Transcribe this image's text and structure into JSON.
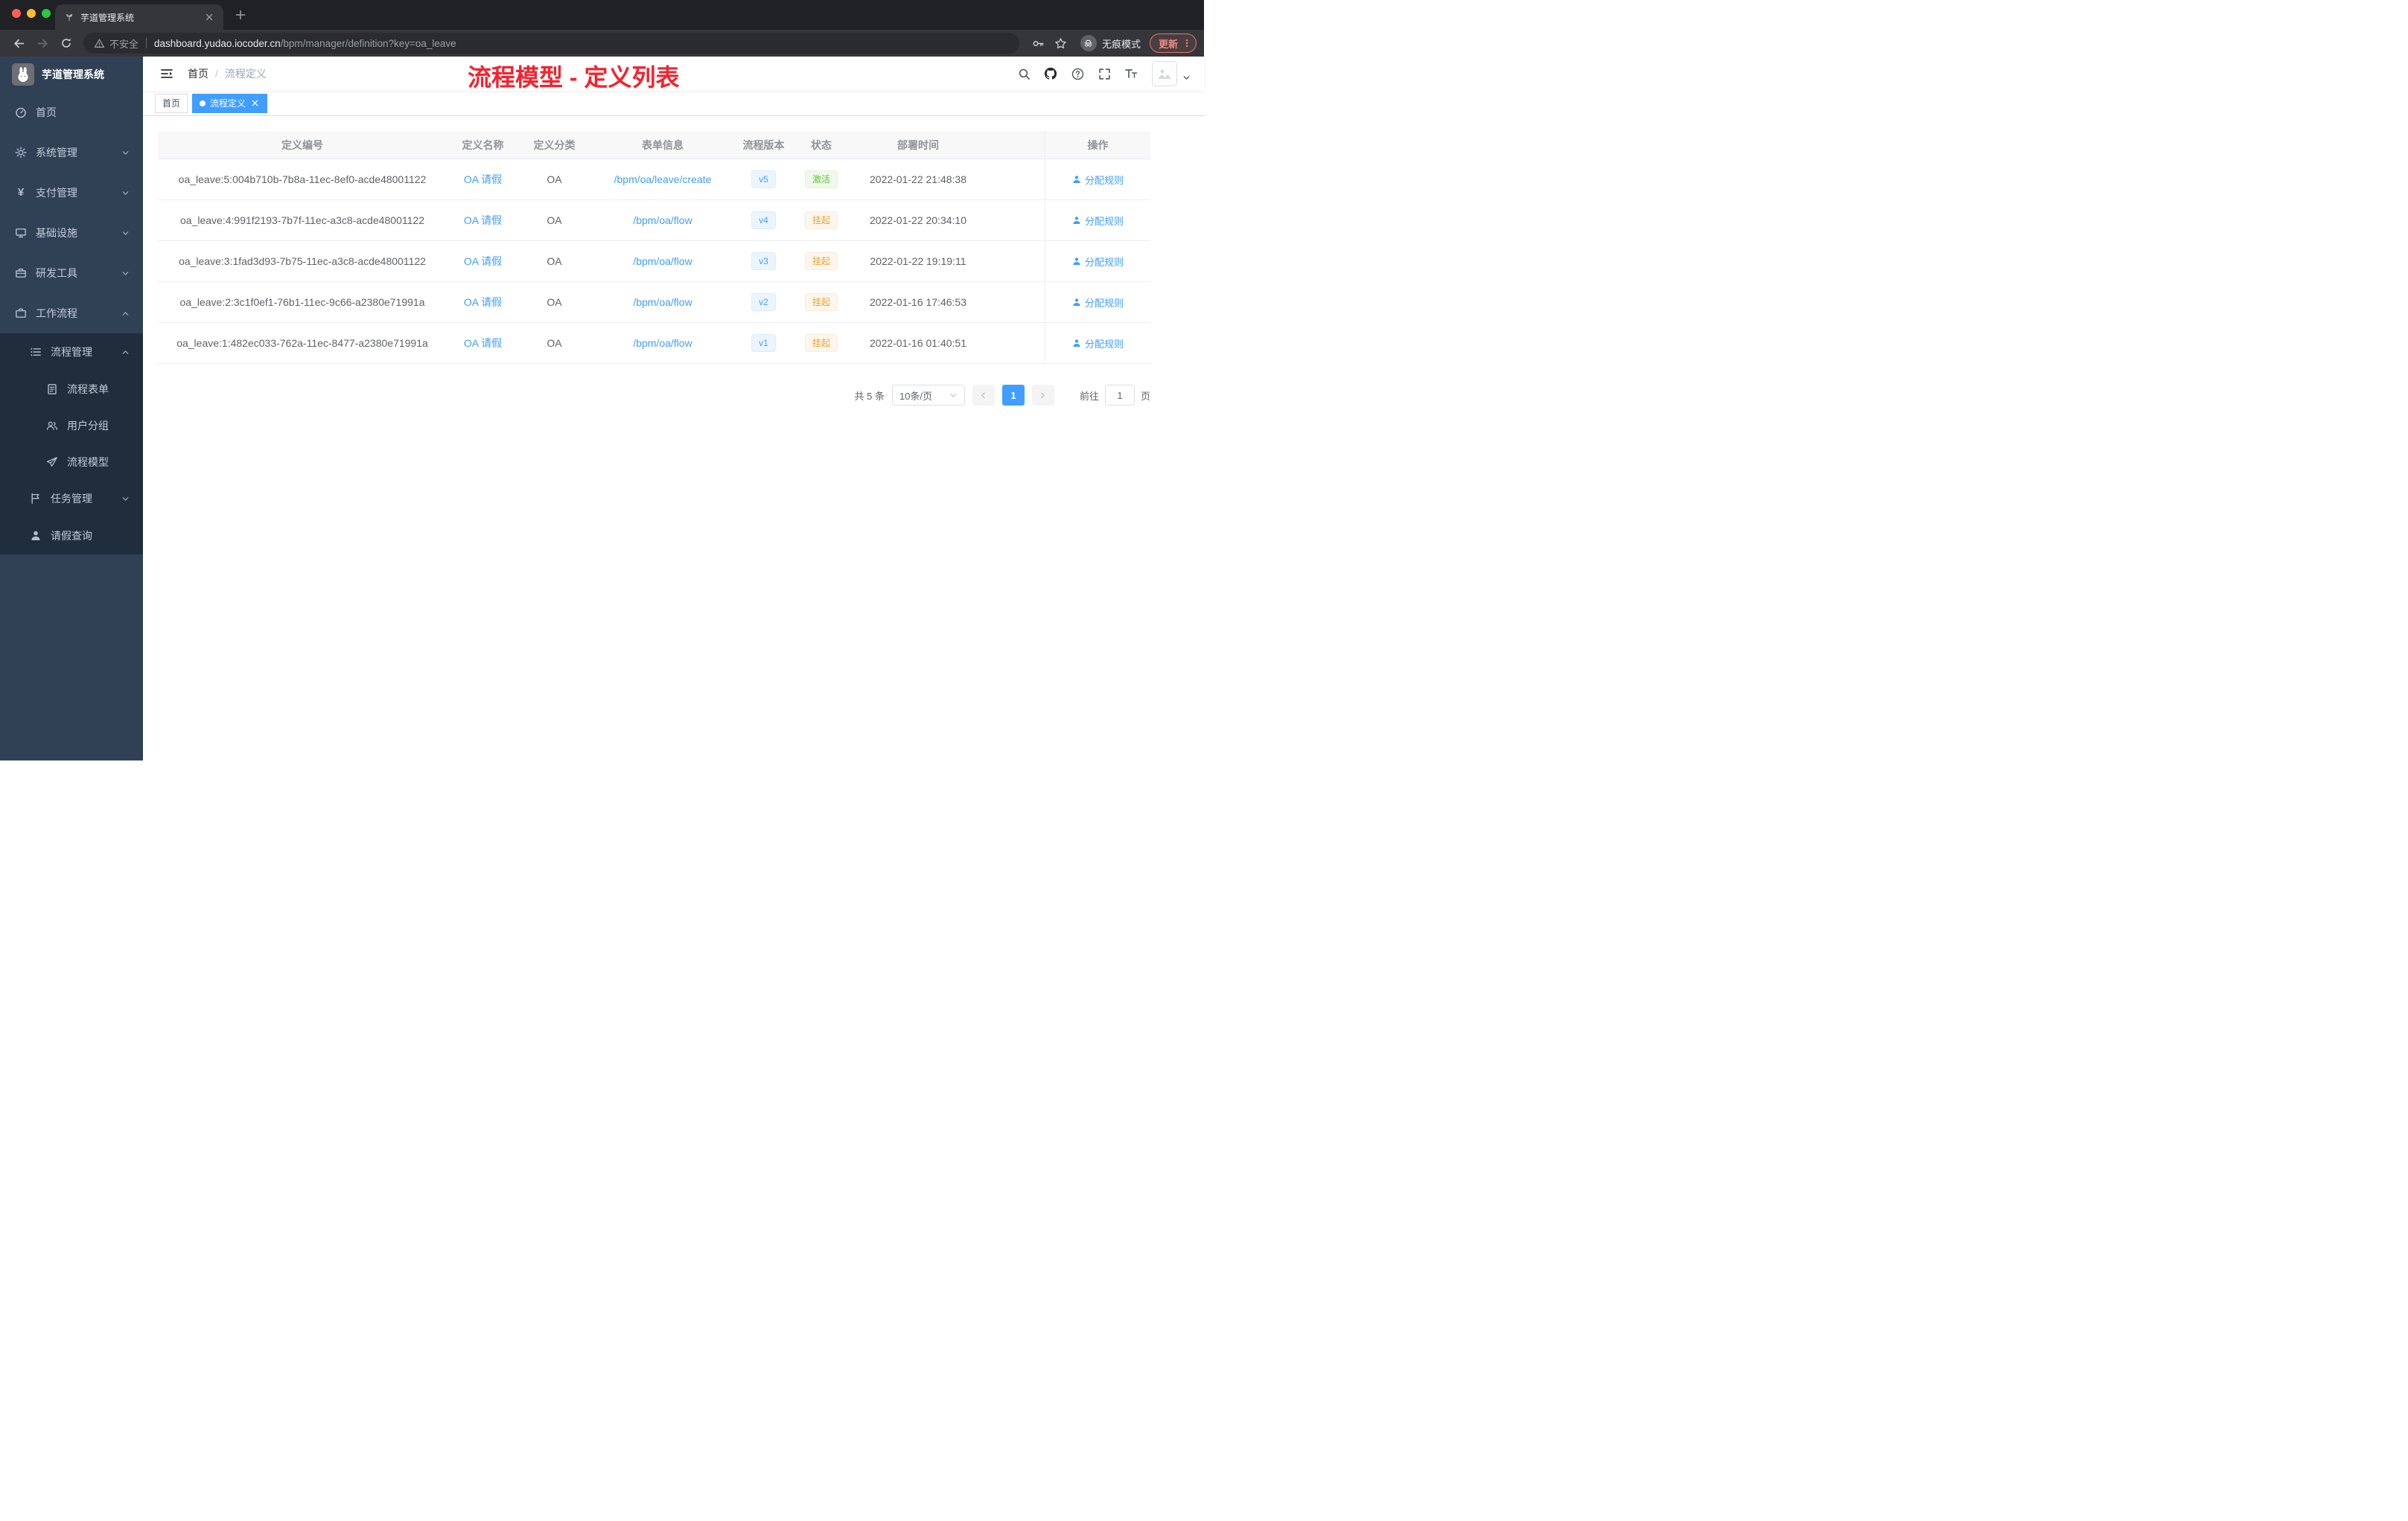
{
  "browser": {
    "tab_title": "芋道管理系统",
    "security_label": "不安全",
    "url_domain": "dashboard.yudao.iocoder.cn",
    "url_path": "/bpm/manager/definition?key=oa_leave",
    "incognito_label": "无痕模式",
    "update_label": "更新"
  },
  "sidebar": {
    "logo_title": "芋道管理系统",
    "items": [
      {
        "label": "首页"
      },
      {
        "label": "系统管理"
      },
      {
        "label": "支付管理"
      },
      {
        "label": "基础设施"
      },
      {
        "label": "研发工具"
      },
      {
        "label": "工作流程"
      },
      {
        "label": "流程管理"
      },
      {
        "label": "流程表单"
      },
      {
        "label": "用户分组"
      },
      {
        "label": "流程模型"
      },
      {
        "label": "任务管理"
      },
      {
        "label": "请假查询"
      }
    ]
  },
  "header": {
    "breadcrumb_home": "首页",
    "breadcrumb_current": "流程定义",
    "annotation": "流程模型 - 定义列表"
  },
  "tags": {
    "home": "首页",
    "active": "流程定义"
  },
  "table": {
    "columns": [
      "定义编号",
      "定义名称",
      "定义分类",
      "表单信息",
      "流程版本",
      "状态",
      "部署时间",
      "操作"
    ],
    "rows": [
      {
        "id": "oa_leave:5:004b710b-7b8a-11ec-8ef0-acde48001122",
        "name": "OA 请假",
        "category": "OA",
        "form": "/bpm/oa/leave/create",
        "version": "v5",
        "status": "激活",
        "time": "2022-01-22 21:48:38",
        "action": "分配规则"
      },
      {
        "id": "oa_leave:4:991f2193-7b7f-11ec-a3c8-acde48001122",
        "name": "OA 请假",
        "category": "OA",
        "form": "/bpm/oa/flow",
        "version": "v4",
        "status": "挂起",
        "time": "2022-01-22 20:34:10",
        "action": "分配规则"
      },
      {
        "id": "oa_leave:3:1fad3d93-7b75-11ec-a3c8-acde48001122",
        "name": "OA 请假",
        "category": "OA",
        "form": "/bpm/oa/flow",
        "version": "v3",
        "status": "挂起",
        "time": "2022-01-22 19:19:11",
        "action": "分配规则"
      },
      {
        "id": "oa_leave:2:3c1f0ef1-76b1-11ec-9c66-a2380e71991a",
        "name": "OA 请假",
        "category": "OA",
        "form": "/bpm/oa/flow",
        "version": "v2",
        "status": "挂起",
        "time": "2022-01-16 17:46:53",
        "action": "分配规则"
      },
      {
        "id": "oa_leave:1:482ec033-762a-11ec-8477-a2380e71991a",
        "name": "OA 请假",
        "category": "OA",
        "form": "/bpm/oa/flow",
        "version": "v1",
        "status": "挂起",
        "time": "2022-01-16 01:40:51",
        "action": "分配规则"
      }
    ]
  },
  "pagination": {
    "total": "共 5 条",
    "page_size": "10条/页",
    "page": "1",
    "goto": "前往",
    "goto_value": "1",
    "unit": "页"
  },
  "colors": {
    "accent": "#409eff",
    "success": "#67c23a",
    "warning": "#e6a23c",
    "annotation_red": "#f5222d",
    "sidebar_bg": "#304156",
    "submenu_bg": "#1f2d3d"
  }
}
